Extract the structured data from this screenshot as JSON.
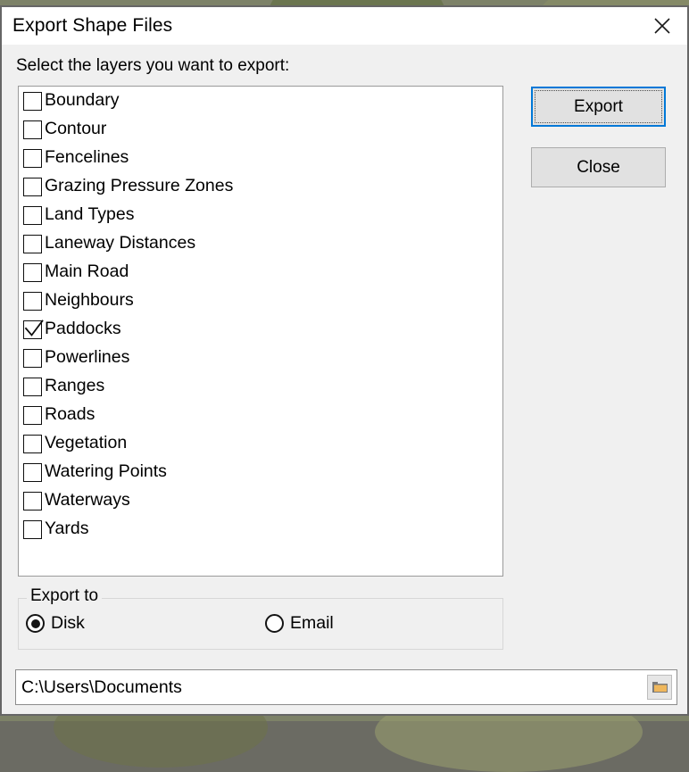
{
  "window": {
    "title": "Export Shape Files",
    "close_icon": "close-x-icon"
  },
  "content": {
    "instruction": "Select the layers you want to export:"
  },
  "layers": [
    {
      "label": "Boundary",
      "checked": false
    },
    {
      "label": "Contour",
      "checked": false
    },
    {
      "label": "Fencelines",
      "checked": false
    },
    {
      "label": "Grazing Pressure Zones",
      "checked": false
    },
    {
      "label": "Land Types",
      "checked": false
    },
    {
      "label": "Laneway Distances",
      "checked": false
    },
    {
      "label": "Main Road",
      "checked": false
    },
    {
      "label": "Neighbours",
      "checked": false
    },
    {
      "label": "Paddocks",
      "checked": true
    },
    {
      "label": "Powerlines",
      "checked": false
    },
    {
      "label": "Ranges",
      "checked": false
    },
    {
      "label": "Roads",
      "checked": false
    },
    {
      "label": "Vegetation",
      "checked": false
    },
    {
      "label": "Watering Points",
      "checked": false
    },
    {
      "label": "Waterways",
      "checked": false
    },
    {
      "label": "Yards",
      "checked": false
    }
  ],
  "buttons": {
    "export_label": "Export",
    "close_label": "Close"
  },
  "export_to": {
    "legend": "Export to",
    "options": [
      {
        "label": "Disk",
        "selected": true
      },
      {
        "label": "Email",
        "selected": false
      }
    ]
  },
  "path": {
    "value": "C:\\Users\\Documents",
    "placeholder": "",
    "browse_icon": "folder-icon"
  },
  "colors": {
    "accent": "#0078D7",
    "button_face": "#E1E1E1",
    "button_border": "#ADADAD",
    "dialog_face": "#F0F0F0",
    "field_bg": "#FFFFFF",
    "window_border": "#666666",
    "folder_icon": "#EFB75C"
  }
}
